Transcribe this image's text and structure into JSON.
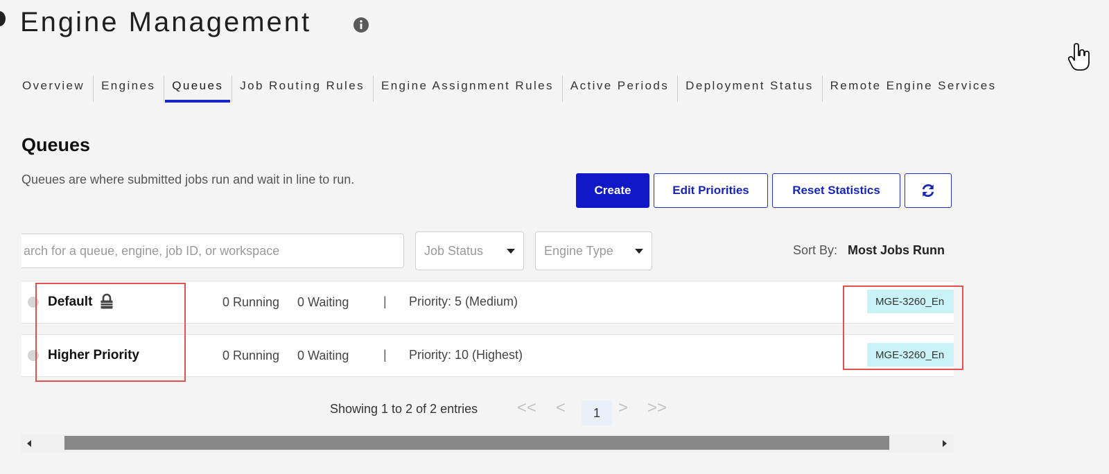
{
  "header": {
    "title": "Engine Management",
    "info_icon": "info-circle-icon"
  },
  "tabs": [
    {
      "label": "Overview",
      "active": false
    },
    {
      "label": "Engines",
      "active": false
    },
    {
      "label": "Queues",
      "active": true
    },
    {
      "label": "Job Routing Rules",
      "active": false
    },
    {
      "label": "Engine Assignment Rules",
      "active": false
    },
    {
      "label": "Active Periods",
      "active": false
    },
    {
      "label": "Deployment Status",
      "active": false
    },
    {
      "label": "Remote Engine Services",
      "active": false
    }
  ],
  "section": {
    "title": "Queues",
    "description": "Queues are where submitted jobs run and wait in line to run."
  },
  "buttons": {
    "create": "Create",
    "edit_priorities": "Edit Priorities",
    "reset_statistics": "Reset Statistics",
    "refresh_icon": "refresh-icon"
  },
  "filters": {
    "search_placeholder": "arch for a queue, engine, job ID, or workspace",
    "job_status": "Job Status",
    "engine_type": "Engine Type",
    "sort_label": "Sort By:",
    "sort_value": "Most Jobs Runn"
  },
  "queues": [
    {
      "name": "Default",
      "locked": true,
      "running": "0 Running",
      "waiting": "0 Waiting",
      "separator": "|",
      "priority": "Priority: 5 (Medium)",
      "engine": "MGE-3260_En"
    },
    {
      "name": "Higher Priority",
      "locked": false,
      "running": "0 Running",
      "waiting": "0 Waiting",
      "separator": "|",
      "priority": "Priority: 10 (Highest)",
      "engine": "MGE-3260_En"
    }
  ],
  "pagination": {
    "showing": "Showing 1 to 2 of 2 entries",
    "first": "<<",
    "prev": "<",
    "current": "1",
    "next": ">",
    "last": ">>"
  },
  "colors": {
    "accent": "#1018c8",
    "tab_underline": "#1826c8",
    "engine_tag_bg": "#c9f2f6",
    "highlight": "#e0504e"
  }
}
